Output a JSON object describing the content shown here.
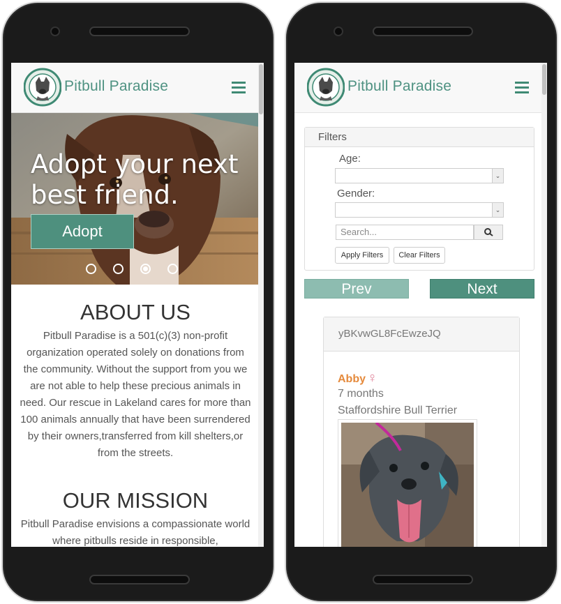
{
  "brand": {
    "name": "Pitbull Paradise"
  },
  "hero": {
    "title_line1": "Adopt your next",
    "title_line2": "best friend.",
    "adopt_label": "Adopt"
  },
  "about": {
    "title": "ABOUT US",
    "text": "Pitbull Paradise is a 501(c)(3) non-profit organization operated solely on donations from the community. Without the support from you we are not able to help these precious animals in need. Our rescue in Lakeland cares for more than 100 animals annually that have been surrendered by their owners,transferred from kill shelters,or from the streets."
  },
  "mission": {
    "title": "OUR MISSION",
    "text": "Pitbull Paradise envisions a compassionate world where pitbulls reside in responsible,"
  },
  "filters": {
    "heading": "Filters",
    "age_label": "Age:",
    "gender_label": "Gender:",
    "search_placeholder": "Search...",
    "apply_label": "Apply Filters",
    "clear_label": "Clear Filters"
  },
  "pager": {
    "prev_label": "Prev",
    "next_label": "Next"
  },
  "pet": {
    "id": "yBKvwGL8FcEwzeJQ",
    "name": "Abby",
    "gender_symbol": "♀",
    "age": "7 months",
    "breed": "Staffordshire Bull Terrier"
  },
  "colors": {
    "brand_green": "#4e907e",
    "prev_green": "#8dbcb0",
    "name_orange": "#e58a3c"
  },
  "icons": {
    "menu": "hamburger-icon",
    "search": "magnifier-icon",
    "select": "chevron-down-icon"
  }
}
